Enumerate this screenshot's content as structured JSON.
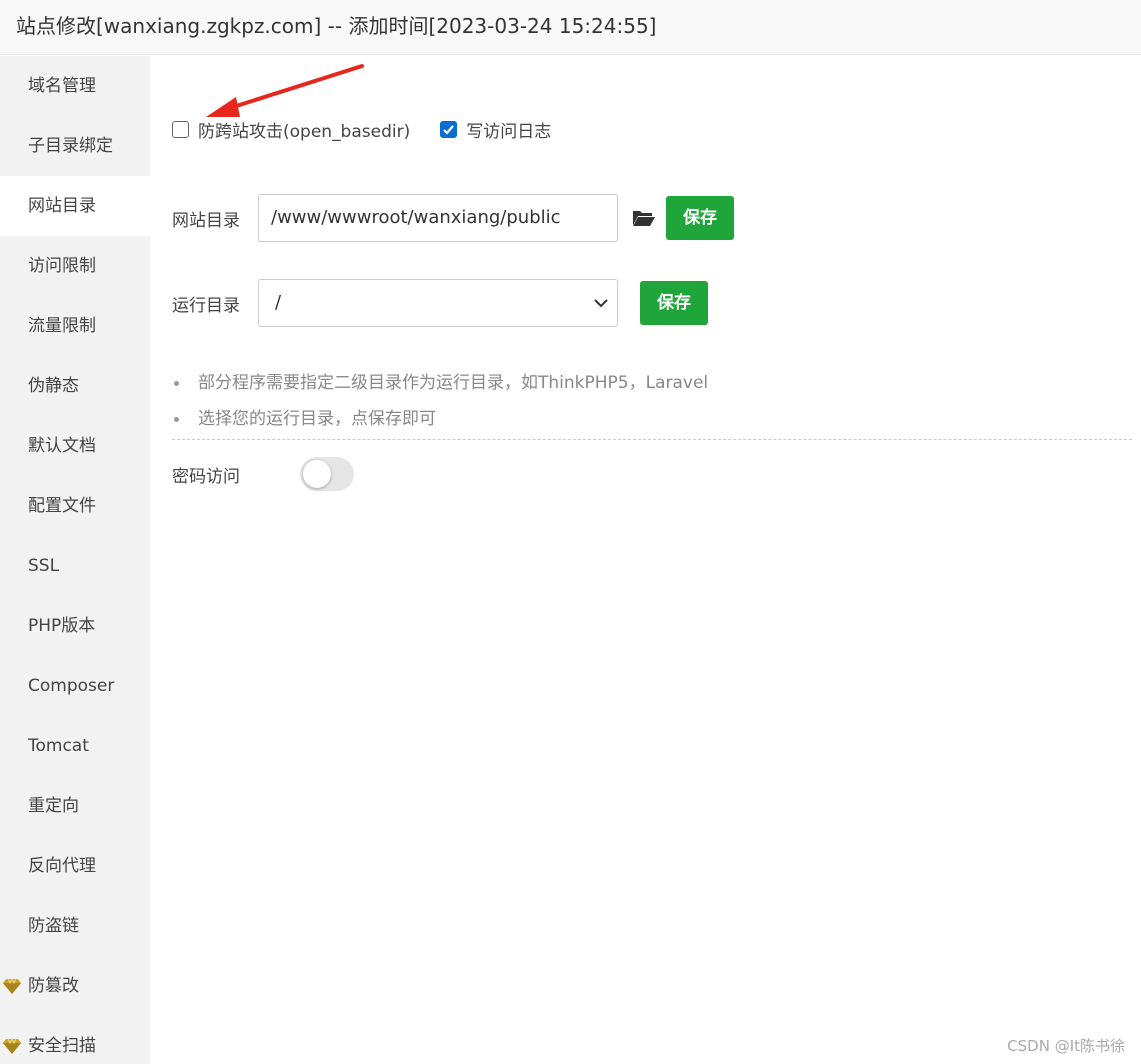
{
  "title": "站点修改[wanxiang.zgkpz.com] -- 添加时间[2023-03-24 15:24:55]",
  "sidebar": {
    "items": [
      {
        "label": "域名管理"
      },
      {
        "label": "子目录绑定"
      },
      {
        "label": "网站目录",
        "active": true
      },
      {
        "label": "访问限制"
      },
      {
        "label": "流量限制"
      },
      {
        "label": "伪静态"
      },
      {
        "label": "默认文档"
      },
      {
        "label": "配置文件"
      },
      {
        "label": "SSL"
      },
      {
        "label": "PHP版本"
      },
      {
        "label": "Composer"
      },
      {
        "label": "Tomcat"
      },
      {
        "label": "重定向"
      },
      {
        "label": "反向代理"
      },
      {
        "label": "防盗链"
      },
      {
        "label": "防篡改",
        "icon": "diamond-icon"
      },
      {
        "label": "安全扫描",
        "icon": "diamond-icon"
      }
    ]
  },
  "options": {
    "open_basedir": {
      "label": "防跨站攻击(open_basedir)",
      "checked": false
    },
    "access_log": {
      "label": "写访问日志",
      "checked": true
    }
  },
  "site_dir": {
    "label": "网站目录",
    "value": "/www/wwwroot/wanxiang/public",
    "save_label": "保存"
  },
  "run_dir": {
    "label": "运行目录",
    "selected": "/",
    "save_label": "保存"
  },
  "tips": [
    "部分程序需要指定二级目录作为运行目录，如ThinkPHP5，Laravel",
    "选择您的运行目录，点保存即可"
  ],
  "password_access": {
    "label": "密码访问",
    "enabled": false
  },
  "watermark": "CSDN @It陈书徐",
  "colors": {
    "primary_button": "#20a53a",
    "checkbox_checked": "#0a6ed1",
    "annotation_arrow": "#e8261c"
  }
}
